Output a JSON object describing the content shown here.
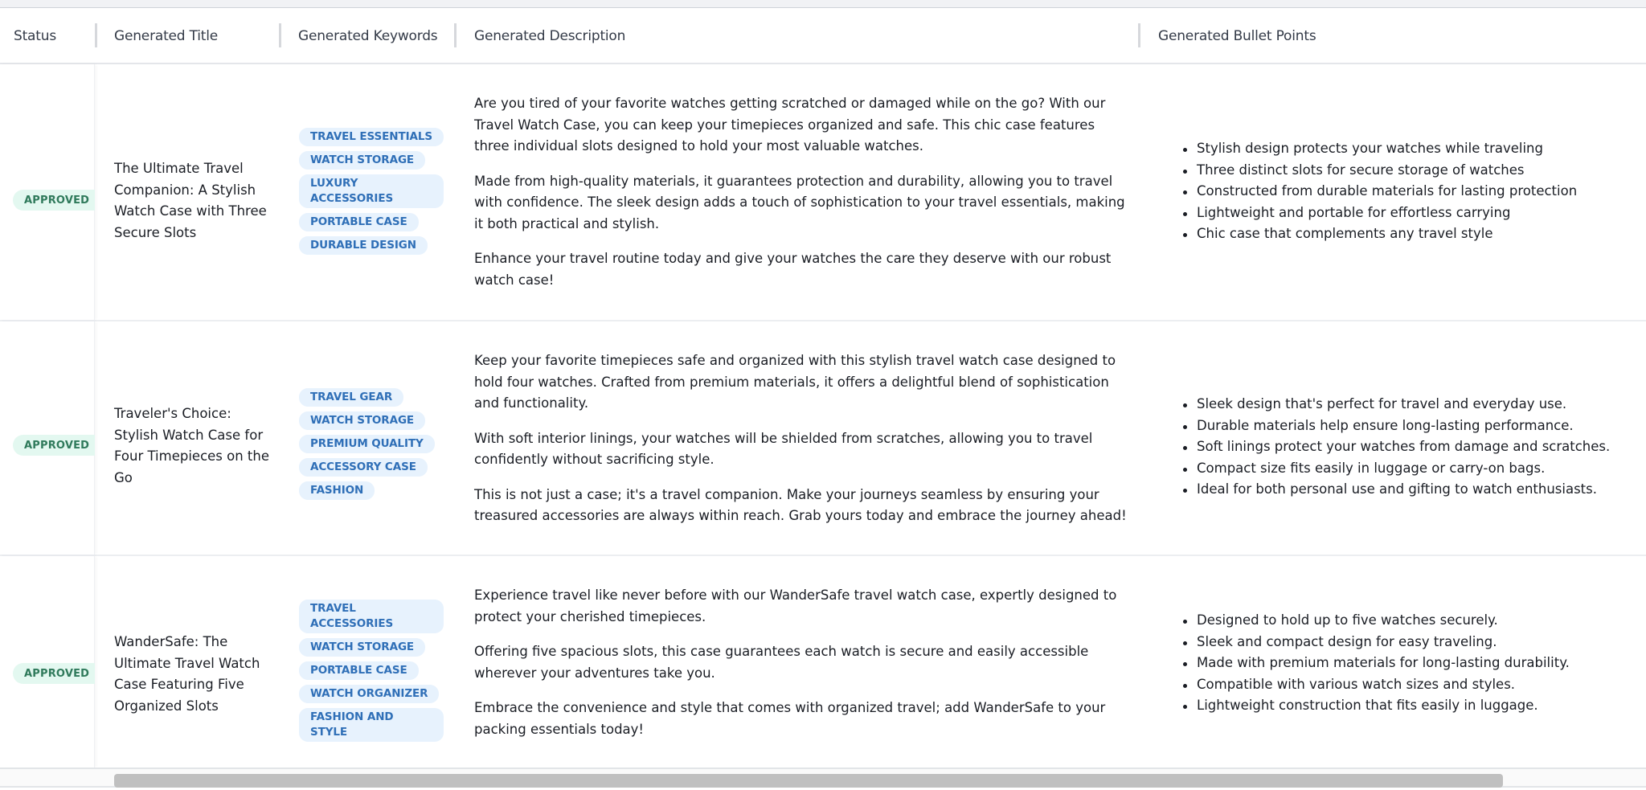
{
  "table": {
    "columns": [
      {
        "key": "status",
        "label": "Status"
      },
      {
        "key": "title",
        "label": "Generated Title"
      },
      {
        "key": "keywords",
        "label": "Generated Keywords"
      },
      {
        "key": "description",
        "label": "Generated Description"
      },
      {
        "key": "bullets",
        "label": "Generated Bullet Points"
      }
    ],
    "rows": [
      {
        "status": "APPROVED",
        "title": "The Ultimate Travel Companion: A Stylish Watch Case with Three Secure Slots",
        "keywords": [
          "TRAVEL ESSENTIALS",
          "WATCH STORAGE",
          "LUXURY ACCESSORIES",
          "PORTABLE CASE",
          "DURABLE DESIGN"
        ],
        "description": [
          "Are you tired of your favorite watches getting scratched or damaged while on the go? With our Travel Watch Case, you can keep your timepieces organized and safe. This chic case features three individual slots designed to hold your most valuable watches.",
          "Made from high-quality materials, it guarantees protection and durability, allowing you to travel with confidence. The sleek design adds a touch of sophistication to your travel essentials, making it both practical and stylish.",
          "Enhance your travel routine today and give your watches the care they deserve with our robust watch case!"
        ],
        "bullets": [
          "Stylish design protects your watches while traveling",
          "Three distinct slots for secure storage of watches",
          "Constructed from durable materials for lasting protection",
          "Lightweight and portable for effortless carrying",
          "Chic case that complements any travel style"
        ]
      },
      {
        "status": "APPROVED",
        "title": "Traveler's Choice: Stylish Watch Case for Four Timepieces on the Go",
        "keywords": [
          "TRAVEL GEAR",
          "WATCH STORAGE",
          "PREMIUM QUALITY",
          "ACCESSORY CASE",
          "FASHION"
        ],
        "description": [
          "Keep your favorite timepieces safe and organized with this stylish travel watch case designed to hold four watches. Crafted from premium materials, it offers a delightful blend of sophistication and functionality.",
          "With soft interior linings, your watches will be shielded from scratches, allowing you to travel confidently without sacrificing style.",
          "This is not just a case; it's a travel companion. Make your journeys seamless by ensuring your treasured accessories are always within reach. Grab yours today and embrace the journey ahead!"
        ],
        "bullets": [
          "Sleek design that's perfect for travel and everyday use.",
          "Durable materials help ensure long-lasting performance.",
          "Soft linings protect your watches from damage and scratches.",
          "Compact size fits easily in luggage or carry-on bags.",
          "Ideal for both personal use and gifting to watch enthusiasts."
        ]
      },
      {
        "status": "APPROVED",
        "title": "WanderSafe: The Ultimate Travel Watch Case Featuring Five Organized Slots",
        "keywords": [
          "TRAVEL ACCESSORIES",
          "WATCH STORAGE",
          "PORTABLE CASE",
          "WATCH ORGANIZER",
          "FASHION AND STYLE"
        ],
        "description": [
          "Experience travel like never before with our WanderSafe travel watch case, expertly designed to protect your cherished timepieces.",
          "Offering five spacious slots, this case guarantees each watch is secure and easily accessible wherever your adventures take you.",
          "Embrace the convenience and style that comes with organized travel; add WanderSafe to your packing essentials today!"
        ],
        "bullets": [
          "Designed to hold up to five watches securely.",
          "Sleek and compact design for easy traveling.",
          "Made with premium materials for long-lasting durability.",
          "Compatible with various watch sizes and styles.",
          "Lightweight construction that fits easily in luggage."
        ]
      }
    ]
  },
  "colors": {
    "approved_bg": "#e3f8f0",
    "approved_text": "#2f7a5b",
    "chip_bg": "#e7f2fd",
    "chip_text": "#2f6fb7"
  }
}
